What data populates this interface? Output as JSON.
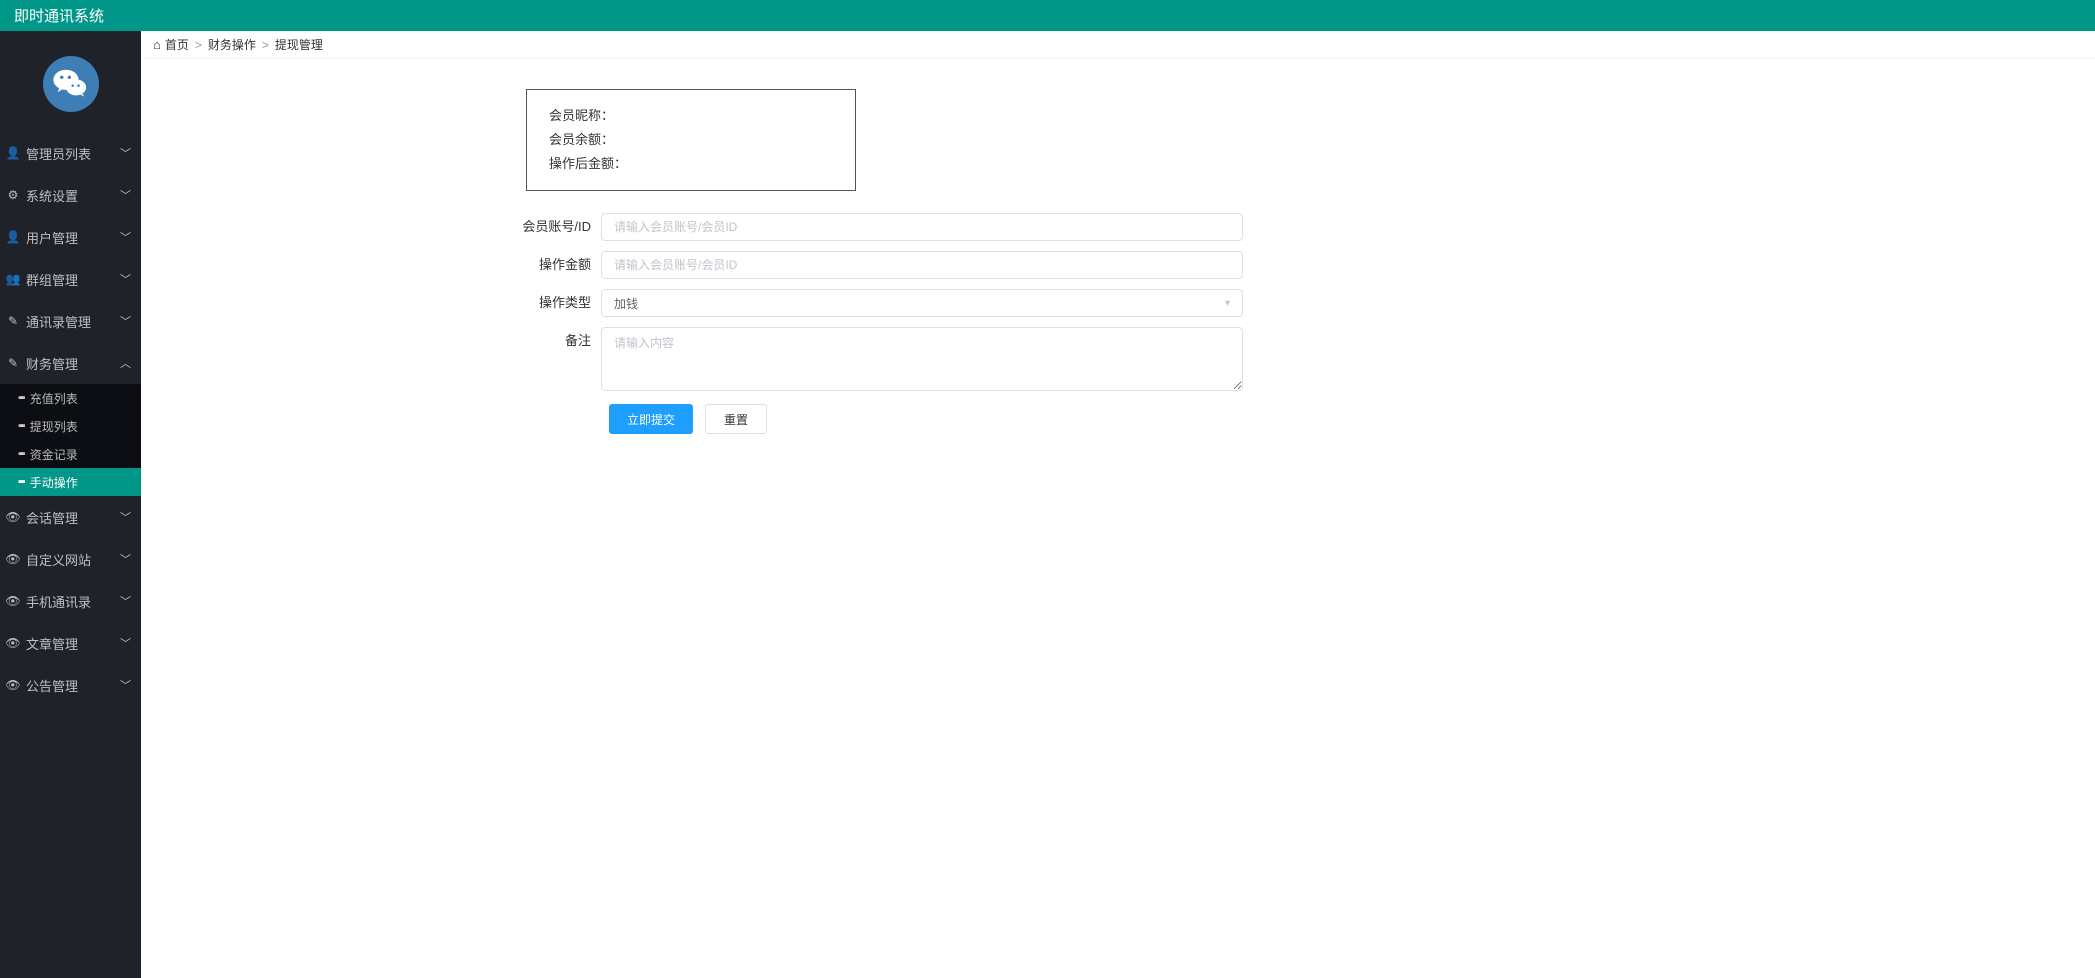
{
  "header": {
    "title": "即时通讯系统"
  },
  "sidebar": {
    "items": [
      {
        "icon": "user",
        "label": "管理员列表",
        "expanded": false
      },
      {
        "icon": "gear",
        "label": "系统设置",
        "expanded": false
      },
      {
        "icon": "user",
        "label": "用户管理",
        "expanded": false
      },
      {
        "icon": "users",
        "label": "群组管理",
        "expanded": false
      },
      {
        "icon": "edit",
        "label": "通讯录管理",
        "expanded": false
      },
      {
        "icon": "edit",
        "label": "财务管理",
        "expanded": true,
        "children": [
          {
            "label": "充值列表",
            "active": false
          },
          {
            "label": "提现列表",
            "active": false
          },
          {
            "label": "资金记录",
            "active": false
          },
          {
            "label": "手动操作",
            "active": true
          }
        ]
      },
      {
        "icon": "eye",
        "label": "会话管理",
        "expanded": false
      },
      {
        "icon": "eye",
        "label": "自定义网站",
        "expanded": false
      },
      {
        "icon": "eye",
        "label": "手机通讯录",
        "expanded": false
      },
      {
        "icon": "eye",
        "label": "文章管理",
        "expanded": false
      },
      {
        "icon": "eye",
        "label": "公告管理",
        "expanded": false
      }
    ]
  },
  "breadcrumb": {
    "home": "首页",
    "items": [
      "财务操作",
      "提现管理"
    ]
  },
  "infobox": {
    "row1": "会员昵称：",
    "row2": "会员余额：",
    "row3": "操作后金额："
  },
  "form": {
    "fields": {
      "account_label": "会员账号/ID",
      "account_placeholder": "请输入会员账号/会员ID",
      "amount_label": "操作金额",
      "amount_placeholder": "请输入会员账号/会员ID",
      "type_label": "操作类型",
      "type_value": "加钱",
      "remark_label": "备注",
      "remark_placeholder": "请输入内容"
    },
    "buttons": {
      "submit": "立即提交",
      "reset": "重置"
    }
  }
}
